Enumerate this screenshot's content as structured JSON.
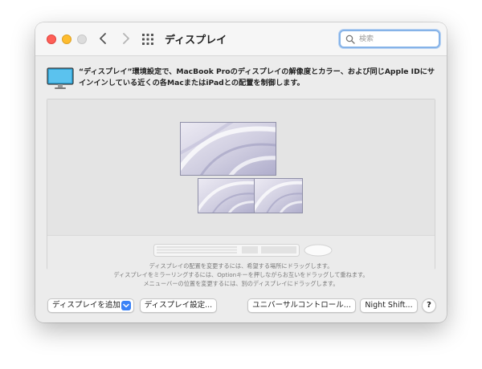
{
  "window": {
    "title": "ディスプレイ"
  },
  "search": {
    "placeholder": "検索"
  },
  "description": "“ディスプレイ”環境設定で、MacBook Proのディスプレイの解像度とカラー、および同じApple IDにサインインしている近くの各MacまたはiPadとの配置を制御します。",
  "hints": [
    "ディスプレイの配置を変更するには、希望する場所にドラッグします。",
    "ディスプレイをミラーリングするには、Optionキーを押しながらお互いをドラッグして重ねます。",
    "メニューバーの位置を変更するには、別のディスプレイにドラッグします。"
  ],
  "buttons": {
    "add_display": "ディスプレイを追加",
    "display_settings": "ディスプレイ設定...",
    "universal_control": "ユニバーサルコントロール...",
    "night_shift": "Night Shift...",
    "help": "?"
  },
  "colors": {
    "close": "#fe5f57",
    "minimize": "#febc2e",
    "zoom_disabled": "#dcdcdc",
    "accent": "#3a82f7",
    "search_focus_ring": "#86b3e8"
  },
  "icons": {
    "traffic_lights": [
      "close-icon",
      "minimize-icon",
      "zoom-icon"
    ],
    "navigation": [
      "chevron-left-icon",
      "chevron-right-icon"
    ],
    "show_all": "grid-icon",
    "search": "magnifier-icon",
    "info": "display-monitor-icon",
    "dropdown": "chevron-down-icon",
    "peripherals": [
      "keyboard-icon",
      "mouse-icon"
    ]
  }
}
